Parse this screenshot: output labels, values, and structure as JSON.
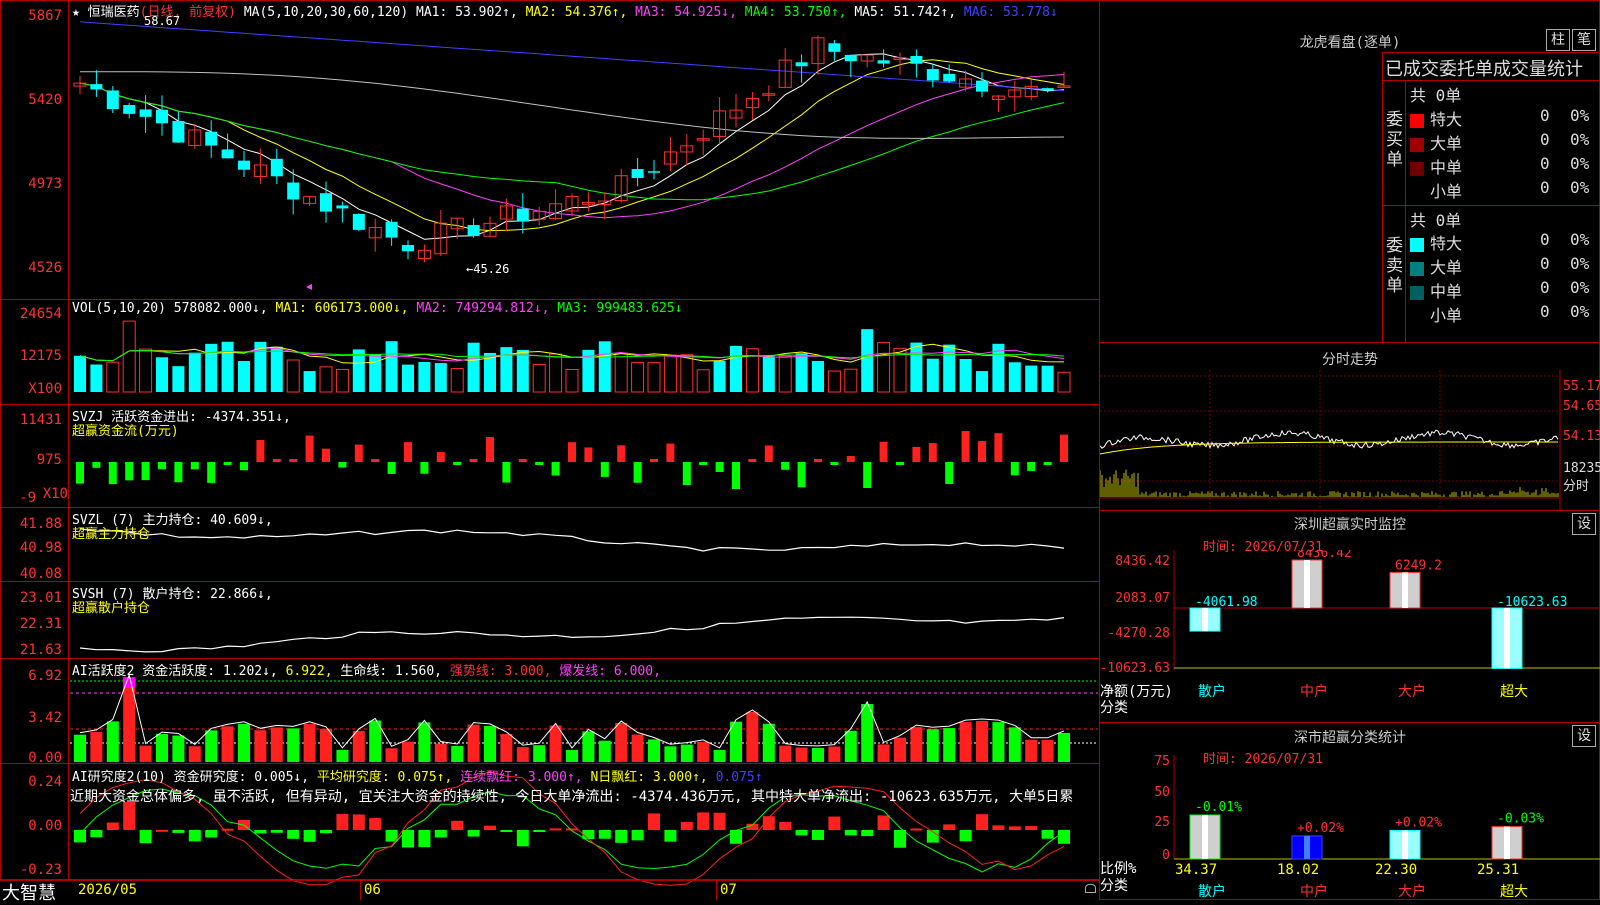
{
  "kline": {
    "title_star": "★",
    "stock_name": "恒瑞医药",
    "mode": "(日线, 前复权)",
    "ma_label": "MA(5,10,20,30,60,120)",
    "ma1": "MA1: 53.902↑,",
    "ma2": "MA2: 54.376↑,",
    "ma3": "MA3: 54.925↓,",
    "ma4": "MA4: 53.750↑,",
    "ma5": "MA5: 51.742↑,",
    "ma6": "MA6: 53.778↓",
    "y_ticks": [
      "5867",
      "5420",
      "4973",
      "4526"
    ],
    "high_mark": "58.67",
    "low_mark": "←45.26"
  },
  "vol": {
    "label": "VOL(5,10,20)",
    "value": "578082.000↓,",
    "ma1": "MA1: 606173.000↓,",
    "ma2": "MA2: 749294.812↓,",
    "ma3": "MA3: 999483.625↓",
    "y_ticks": [
      "24654",
      "12175",
      "X100"
    ]
  },
  "svzj": {
    "label": "SVZJ  活跃资金进出: -4374.351↓,",
    "sub": "超赢资金流(万元)",
    "y_ticks": [
      "11431",
      "975",
      "-9",
      "X10"
    ]
  },
  "svzl": {
    "label": "SVZL (7) 主力持仓: 40.609↓,",
    "sub": "超赢主力持仓",
    "y_ticks": [
      "41.88",
      "40.98",
      "40.08"
    ]
  },
  "svsh": {
    "label": "SVSH (7) 散户持仓: 22.866↓,",
    "sub": "超赢散户持仓",
    "y_ticks": [
      "23.01",
      "22.31",
      "21.63"
    ]
  },
  "ai1": {
    "label": "AI活跃度2 资金活跃度: 1.202↓,",
    "v2": "6.922,",
    "v3": "生命线: 1.560,",
    "v4": "强势线: 3.000,",
    "v5": "爆发线: 6.000,",
    "y_ticks": [
      "6.92",
      "3.42",
      "0.00"
    ]
  },
  "ai2": {
    "label": "AI研究度2(10) 资金研究度: 0.005↓,",
    "v2": "平均研究度: 0.075↑,",
    "v3": "连续飘红: 3.000↑,",
    "v4": "N日飘红: 3.000↑,",
    "v5": "0.075↑",
    "commentary": "近期大资金总体偏多, 虽不活跃, 但有异动, 宜关注大资金的持续性, 今日大单净流出: -4374.436万元, 其中特大单净流出: -10623.635万元, 大单5日累",
    "y_ticks": [
      "0.24",
      "0.00",
      "-0.23"
    ]
  },
  "bottom": {
    "brand": "大智慧",
    "dates": [
      "2026/05",
      "06",
      "07"
    ]
  },
  "side": {
    "lhb_title": "龙虎看盘(逐单)",
    "btn_zhu": "柱",
    "btn_bi": "笔",
    "tabs_header": "已成交委托单成交量统计",
    "buy_label": "委买单",
    "sell_label": "委卖单",
    "buy_total": "共 0单",
    "sell_total": "共 0单",
    "rows": [
      "特大",
      "大单",
      "中单",
      "小单"
    ],
    "zero": "0",
    "pct": "0%",
    "buy_colors": [
      "#ff0000",
      "#a00000",
      "#700000",
      "#000000"
    ],
    "sell_colors": [
      "#00ffff",
      "#008080",
      "#006060",
      "#000000"
    ],
    "fenshi_title": "分时走势",
    "fenshi_y": [
      "55.17",
      "54.65",
      "54.13",
      "18235",
      "分时"
    ],
    "sz_title": "深圳超赢实时监控",
    "sz_btn": "设",
    "sz_time": "时间: 2026/07/31",
    "sz_y": [
      "8436.42",
      "2083.07",
      "-4270.28",
      "-10623.63"
    ],
    "sz_unit": "净额(万元)",
    "sz_cat_label": "分类",
    "sz_values": [
      "-4061.98",
      "8436.42",
      "6249.2",
      "-10623.63"
    ],
    "sz_cats": [
      "散户",
      "中户",
      "大户",
      "超大"
    ],
    "fl_title": "深市超赢分类统计",
    "fl_btn": "设",
    "fl_time": "时间: 2026/07/31",
    "fl_y": [
      "75",
      "50",
      "25",
      "0"
    ],
    "fl_unit": "比例%",
    "fl_cat_label": "分类",
    "fl_changes": [
      "-0.01%",
      "+0.02%",
      "+0.02%",
      "-0.03%"
    ],
    "fl_values": [
      "34.37",
      "18.02",
      "22.30",
      "25.31"
    ],
    "fl_cats": [
      "散户",
      "中户",
      "大户",
      "超大"
    ]
  }
}
